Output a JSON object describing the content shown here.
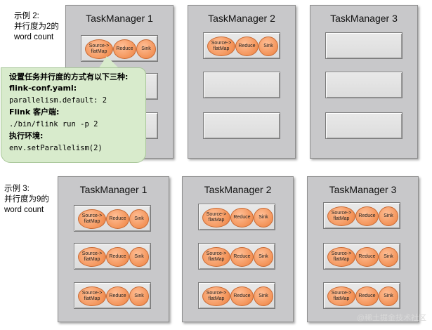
{
  "example2": {
    "l1": "示例 2:",
    "l2": "并行度为2的",
    "l3": "word count"
  },
  "example3": {
    "l1": "示例 3:",
    "l2": "并行度为9的",
    "l3": "word count"
  },
  "bubble": {
    "l1": "设置任务并行度的方式有以下三种:",
    "l2": "flink-conf.yaml:",
    "l3": "parallelism.default: 2",
    "l4": "Flink 客户端:",
    "l5": "./bin/flink run -p 2",
    "l6": "执行环境:",
    "l7": "env.setParallelism(2)"
  },
  "tm": {
    "t1": "TaskManager 1",
    "t2": "TaskManager 2",
    "t3": "TaskManager 3"
  },
  "ops": {
    "source": "Source->\nflatMap",
    "reduce": "Reduce",
    "sink": "Sink"
  },
  "watermark": "@稀土掘金技术社区"
}
